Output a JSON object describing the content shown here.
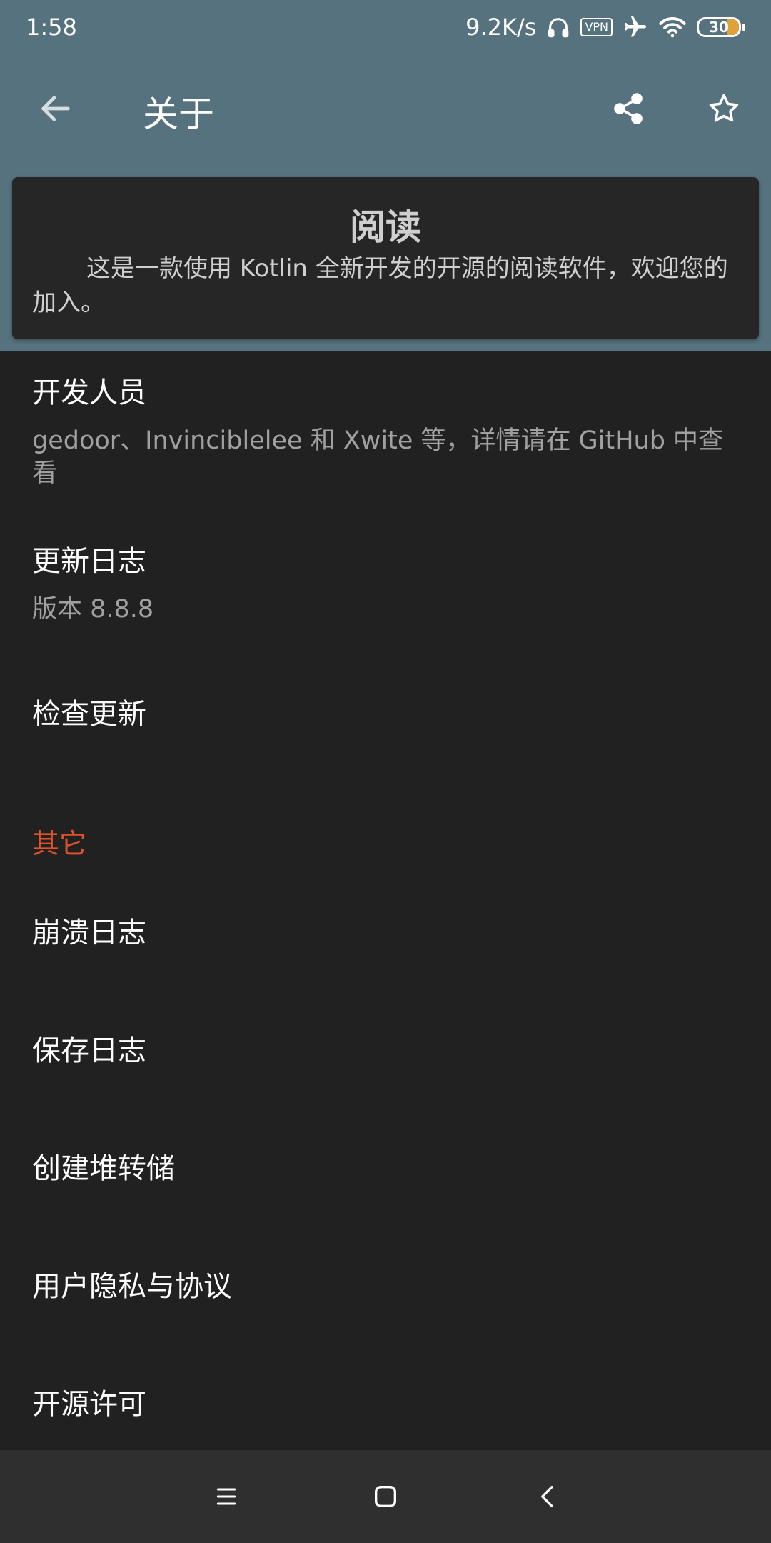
{
  "status_bar": {
    "time": "1:58",
    "network_speed": "9.2K/s",
    "vpn_label": "VPN",
    "battery_level": "30"
  },
  "toolbar": {
    "title": "关于"
  },
  "about_card": {
    "app_name": "阅读",
    "description": "这是一款使用 Kotlin 全新开发的开源的阅读软件，欢迎您的加入。"
  },
  "preferences": {
    "developers": {
      "title": "开发人员",
      "summary": "gedoor、Invinciblelee 和 Xwite 等，详情请在 GitHub 中查看"
    },
    "changelog": {
      "title": "更新日志",
      "summary": "版本 8.8.8"
    },
    "check_update": {
      "title": "检查更新"
    },
    "category_other": "其它",
    "crash_log": {
      "title": "崩溃日志"
    },
    "save_log": {
      "title": "保存日志"
    },
    "heap_dump": {
      "title": "创建堆转储"
    },
    "privacy": {
      "title": "用户隐私与协议"
    },
    "license": {
      "title": "开源许可"
    }
  },
  "colors": {
    "toolbar_bg": "#56727f",
    "page_bg": "#212121",
    "card_bg": "#262626",
    "accent": "#e0522a",
    "battery_fill": "#e0a13a"
  },
  "icons": {
    "back": "arrow-left-icon",
    "share": "share-icon",
    "star": "star-outline-icon",
    "nav_menu": "menu-icon",
    "nav_home": "home-square-icon",
    "nav_back": "chevron-left-icon"
  }
}
